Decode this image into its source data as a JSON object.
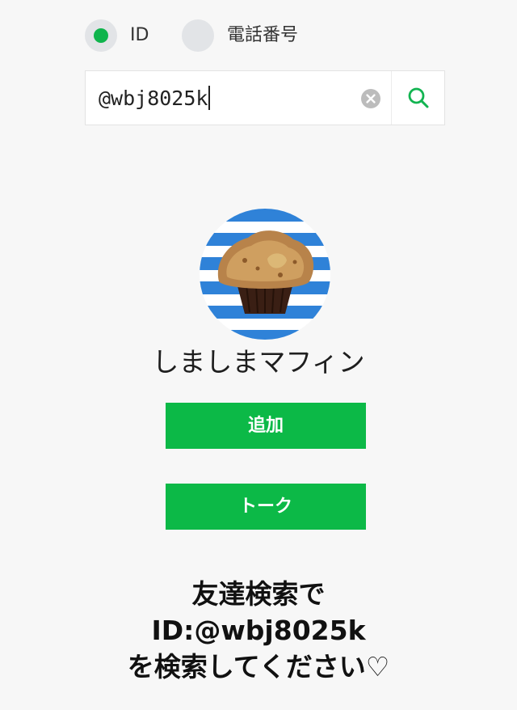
{
  "search_type": {
    "selected": "id",
    "options": [
      {
        "key": "id",
        "label": "ID"
      },
      {
        "key": "phone",
        "label": "電話番号"
      }
    ]
  },
  "search": {
    "query": "@wbj8025k"
  },
  "profile": {
    "name": "しましまマフィン"
  },
  "actions": {
    "add_label": "追加",
    "talk_label": "トーク"
  },
  "caption": {
    "lines": [
      "友達検索で",
      "ID:@wbj8025k",
      "を検索してください♡"
    ]
  },
  "colors": {
    "accent_green": "#0cb947",
    "radio_selected": "#0fb44c",
    "avatar_stripe_blue": "#2f82d8"
  },
  "icons": {
    "clear": "clear-icon",
    "search": "search-icon"
  }
}
